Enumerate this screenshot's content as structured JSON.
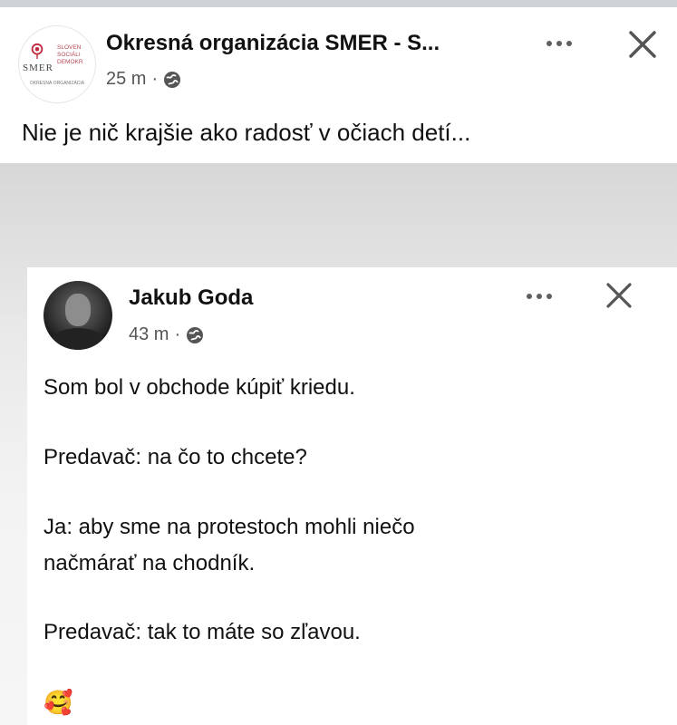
{
  "post": {
    "author": "Okresná organizácia SMER - S...",
    "time": "25 m",
    "separator": "·",
    "text": "Nie je nič krajšie ako radosť v očiach detí...",
    "avatar_logo": {
      "smer": "SMER",
      "right_lines": "SLOVEN SOCIÁLI DEMOKR",
      "small": "OKRESNÁ ORGANIZÁCIA"
    }
  },
  "shared": {
    "author": "Jakub Goda",
    "time": "43 m",
    "separator": "·",
    "lines": [
      "Som bol v obchode kúpiť kriedu.",
      "Predavač: na čo to chcete?",
      "Ja: aby sme na protestoch mohli niečo",
      "načmárať na chodník.",
      "Predavač: tak to máte so zľavou."
    ],
    "emoji": "🥰"
  },
  "icons": {
    "globe": "globe-icon",
    "more": "more-options-icon",
    "close": "close-icon"
  },
  "colors": {
    "rose": "#c0273a",
    "text": "#111111",
    "meta": "#555555"
  }
}
